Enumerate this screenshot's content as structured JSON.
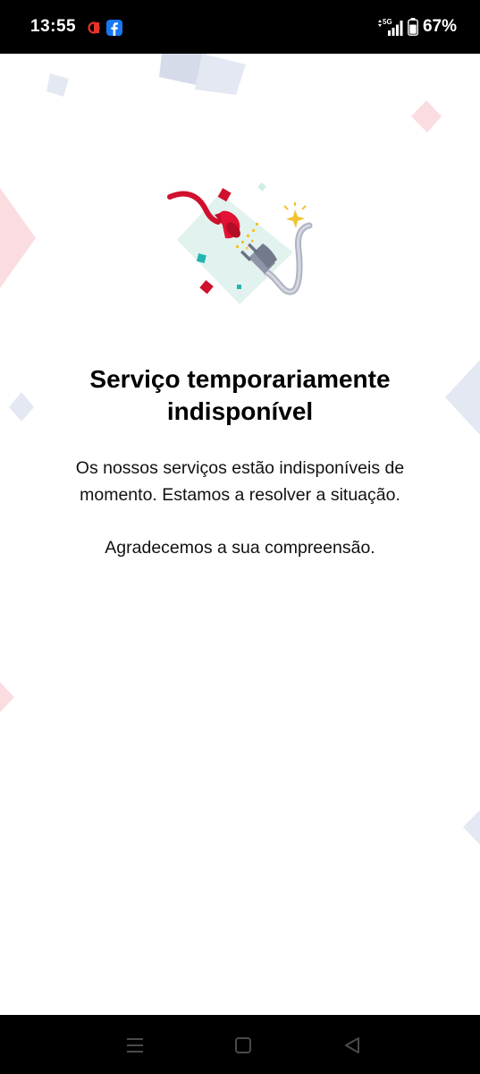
{
  "status_bar": {
    "time": "13:55",
    "network": "5G",
    "battery": "67%"
  },
  "icons": {
    "status": [
      "opera-icon",
      "facebook-icon",
      "data-arrows-icon",
      "signal-icon",
      "battery-icon"
    ],
    "navigation": [
      "menu-icon",
      "home-icon",
      "back-icon"
    ],
    "illustration": "unplugged-cable-illustration"
  },
  "colors": {
    "accent_red": "#d0102e",
    "deco_pink": "#fbdde1",
    "deco_blue": "#e4e8f2",
    "deco_mint": "#e2f2ee",
    "plug_grey": "#8e95a7",
    "text": "#000000"
  },
  "main": {
    "title": "Serviço temporariamente indisponível",
    "message": "Os nossos serviços estão indisponíveis de momento. Estamos a resolver a situação.",
    "thanks": "Agradecemos a sua compreensão."
  }
}
